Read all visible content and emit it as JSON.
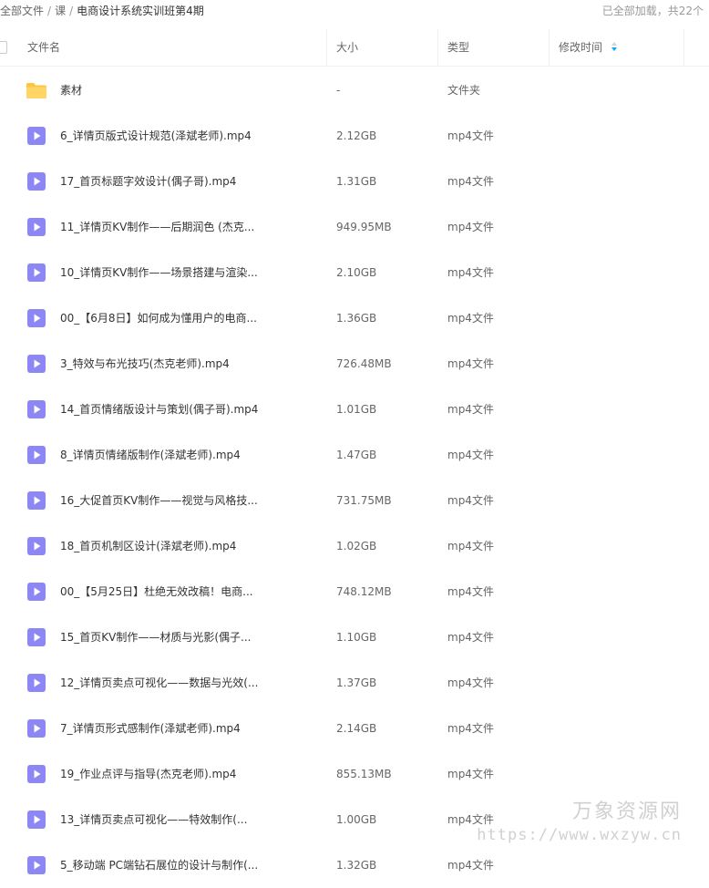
{
  "breadcrumb": {
    "items": [
      "全部文件",
      "课",
      "电商设计系统实训班第4期"
    ],
    "separator": "/"
  },
  "load_status": "已全部加载，共22个",
  "table": {
    "columns": {
      "name": "文件名",
      "size": "大小",
      "type": "类型",
      "modified": "修改时间"
    },
    "rows": [
      {
        "icon": "folder-icon",
        "name": "素材",
        "size": "-",
        "type": "文件夹"
      },
      {
        "icon": "video-file-icon",
        "name": "6_详情页版式设计规范(泽斌老师).mp4",
        "size": "2.12GB",
        "type": "mp4文件"
      },
      {
        "icon": "video-file-icon",
        "name": "17_首页标题字效设计(偶子哥).mp4",
        "size": "1.31GB",
        "type": "mp4文件"
      },
      {
        "icon": "video-file-icon",
        "name": "11_详情页KV制作——后期润色 (杰克...",
        "size": "949.95MB",
        "type": "mp4文件"
      },
      {
        "icon": "video-file-icon",
        "name": "10_详情页KV制作——场景搭建与渲染...",
        "size": "2.10GB",
        "type": "mp4文件"
      },
      {
        "icon": "video-file-icon",
        "name": "00_【6月8日】如何成为懂用户的电商...",
        "size": "1.36GB",
        "type": "mp4文件"
      },
      {
        "icon": "video-file-icon",
        "name": "3_特效与布光技巧(杰克老师).mp4",
        "size": "726.48MB",
        "type": "mp4文件"
      },
      {
        "icon": "video-file-icon",
        "name": "14_首页情绪版设计与策划(偶子哥).mp4",
        "size": "1.01GB",
        "type": "mp4文件"
      },
      {
        "icon": "video-file-icon",
        "name": "8_详情页情绪版制作(泽斌老师).mp4",
        "size": "1.47GB",
        "type": "mp4文件"
      },
      {
        "icon": "video-file-icon",
        "name": "16_大促首页KV制作——视觉与风格技...",
        "size": "731.75MB",
        "type": "mp4文件"
      },
      {
        "icon": "video-file-icon",
        "name": "18_首页机制区设计(泽斌老师).mp4",
        "size": "1.02GB",
        "type": "mp4文件"
      },
      {
        "icon": "video-file-icon",
        "name": "00_【5月25日】杜绝无效改稿！电商...",
        "size": "748.12MB",
        "type": "mp4文件"
      },
      {
        "icon": "video-file-icon",
        "name": "15_首页KV制作——材质与光影(偶子...",
        "size": "1.10GB",
        "type": "mp4文件"
      },
      {
        "icon": "video-file-icon",
        "name": "12_详情页卖点可视化——数据与光效(...",
        "size": "1.37GB",
        "type": "mp4文件"
      },
      {
        "icon": "video-file-icon",
        "name": "7_详情页形式感制作(泽斌老师).mp4",
        "size": "2.14GB",
        "type": "mp4文件"
      },
      {
        "icon": "video-file-icon",
        "name": "19_作业点评与指导(杰克老师).mp4",
        "size": "855.13MB",
        "type": "mp4文件"
      },
      {
        "icon": "video-file-icon",
        "name": "13_详情页卖点可视化——特效制作(...",
        "size": "1.00GB",
        "type": "mp4文件"
      },
      {
        "icon": "video-file-icon",
        "name": "5_移动端 PC端钻石展位的设计与制作(...",
        "size": "1.32GB",
        "type": "mp4文件"
      }
    ]
  },
  "watermark": {
    "title": "万象资源网",
    "url": "https://www.wxzyw.cn"
  },
  "colors": {
    "folder": "#ffc53d",
    "video_icon": "#8d86f5",
    "sort_active": "#06a7ff"
  }
}
